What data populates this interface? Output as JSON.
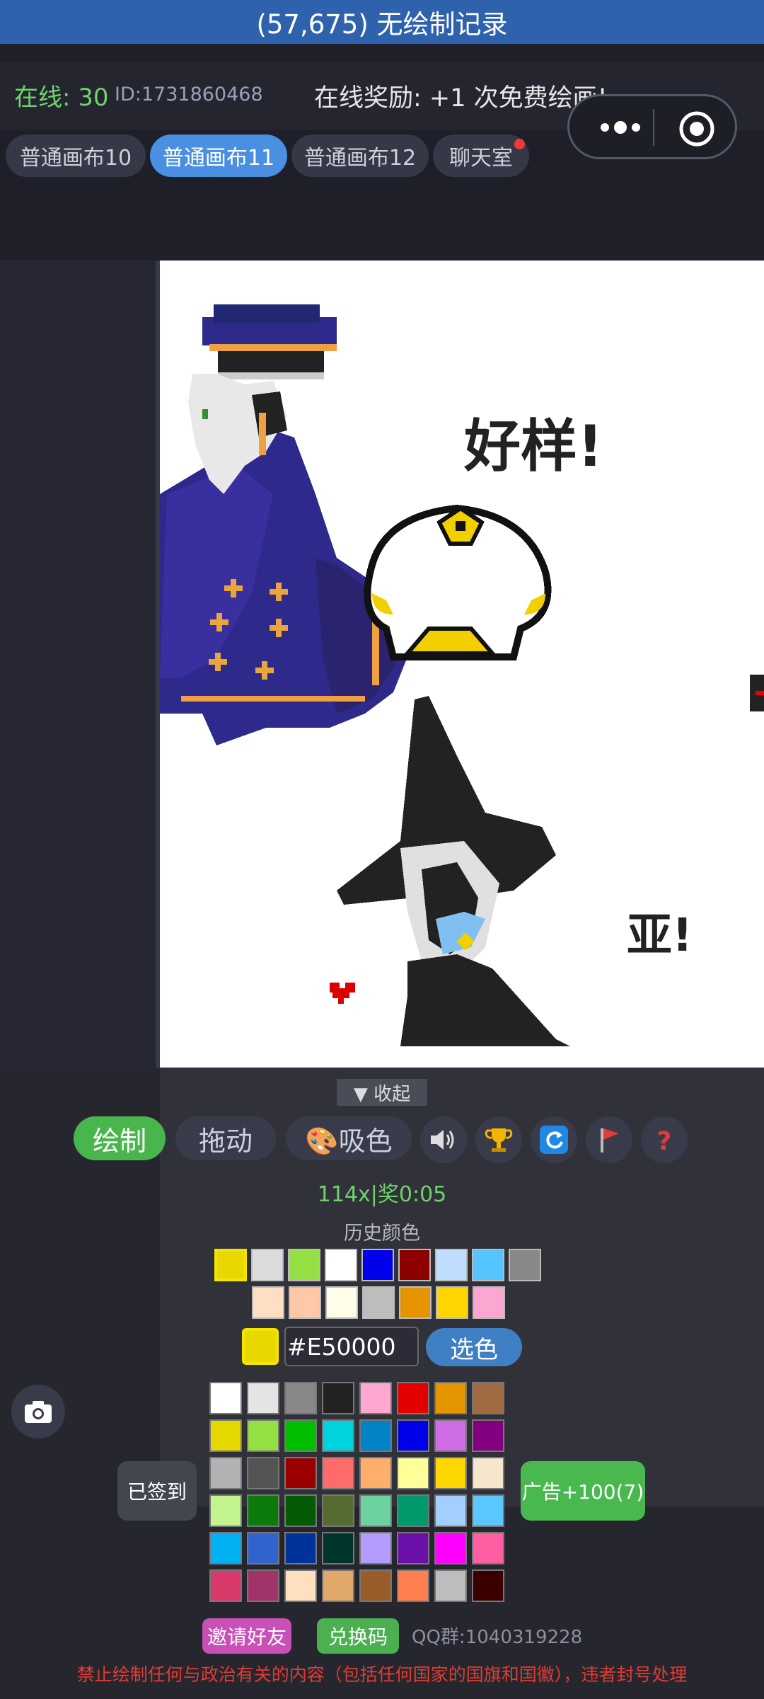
{
  "header": {
    "title": "(57,675) 无绘制记录"
  },
  "info": {
    "online": "在线: 30",
    "user_id": "ID:1731860468",
    "reward": "在线奖励: +1 次免费绘画!"
  },
  "tabs": [
    {
      "label": "普通画布10",
      "active": false
    },
    {
      "label": "普通画布11",
      "active": true
    },
    {
      "label": "普通画布12",
      "active": false
    },
    {
      "label": "聊天室",
      "active": false,
      "badge": true
    }
  ],
  "canvas": {
    "text_1": "好样!",
    "text_2": "亚!"
  },
  "panel": {
    "collapse": "▼ 收起",
    "draw": "绘制",
    "drag": "拖动",
    "pick": "🎨吸色",
    "timer": "114x|奖0:05",
    "history_label": "历史颜色",
    "current_hex": "#E50000",
    "choose": "选色",
    "signed": "已签到",
    "ad": "广告+100(7)",
    "invite": "邀请好友",
    "redeem": "兑换码",
    "qq": "QQ群:1040319228",
    "warning": "禁止绘制任何与政治有关的内容（包括任何国家的国旗和国徽），违者封号处理"
  },
  "colors": {
    "history_row1": [
      "#E8D800",
      "#DCDCDC",
      "#94E044",
      "#FFFFFF",
      "#0000EA",
      "#8E0000",
      "#BEDDFF",
      "#55C4FF",
      "#888888"
    ],
    "history_row2": [
      "#FFDFC3",
      "#FFC8A8",
      "#FFFDE8",
      "#BDBDBD",
      "#E59400",
      "#FFD500",
      "#FCA7D2"
    ],
    "current": "#E8D800",
    "palette": [
      [
        "#FFFFFF",
        "#E4E4E4",
        "#888888",
        "#222222",
        "#FFA7D1",
        "#E50000",
        "#E59500",
        "#A06A42"
      ],
      [
        "#E5D900",
        "#94E044",
        "#02BE01",
        "#00D3DD",
        "#0083C7",
        "#0000EA",
        "#CF6EE4",
        "#820080"
      ],
      [
        "#B2B2B2",
        "#545454",
        "#9A0000",
        "#FF6B6B",
        "#FFAE6B",
        "#FFFF99",
        "#FFD700",
        "#F5E6CC"
      ],
      [
        "#C2F58D",
        "#0B7A0B",
        "#055B05",
        "#556B2F",
        "#6CD3A0",
        "#00996B",
        "#A2CFFF",
        "#5AC8FF"
      ],
      [
        "#00B1F4",
        "#3163CF",
        "#003399",
        "#00352E",
        "#B49CFF",
        "#6A0FA8",
        "#FF00FF",
        "#FF5EA3"
      ],
      [
        "#D93A6B",
        "#A03368",
        "#FFE0BE",
        "#E0A96A",
        "#985D28",
        "#FF7F50",
        "#BDBDBD",
        "#3A0000"
      ]
    ]
  }
}
